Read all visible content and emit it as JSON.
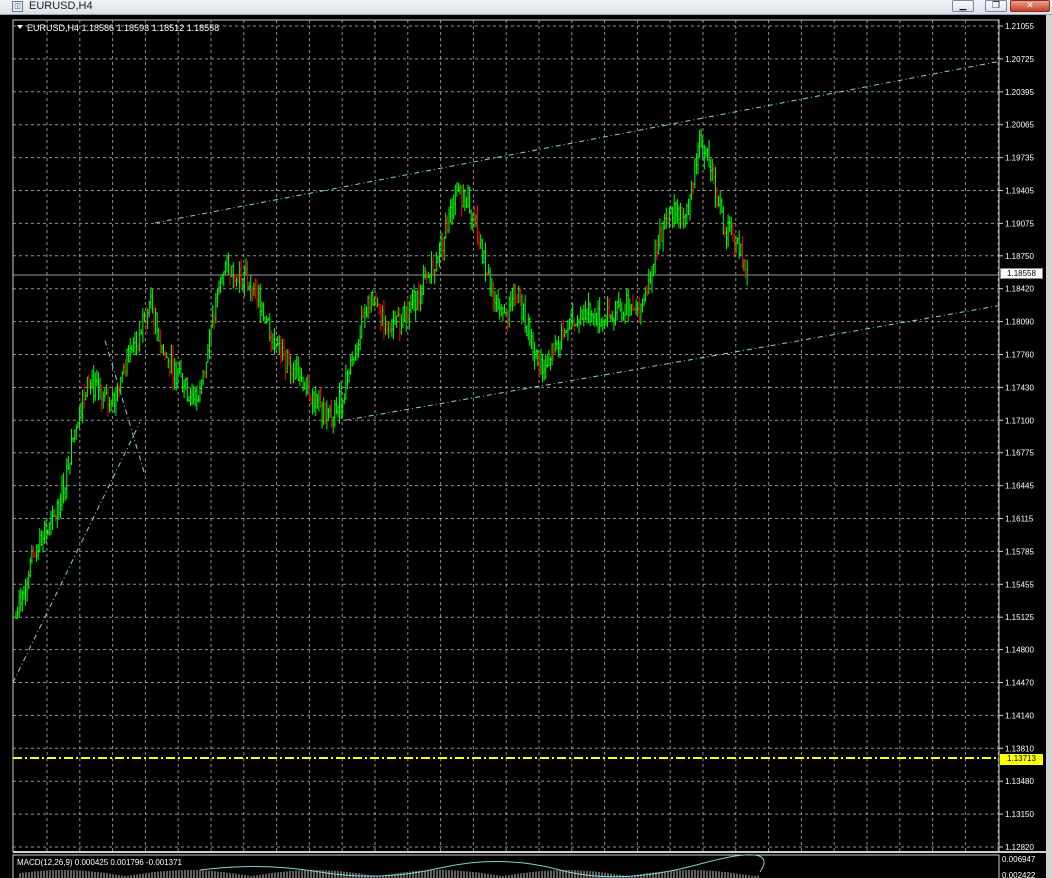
{
  "window": {
    "title": "EURUSD,H4",
    "icon": "chart-window-icon",
    "controls": {
      "minimize": "▁",
      "maximize": "❐",
      "close": "✕"
    }
  },
  "chart": {
    "symbol_info": "EURUSD,H4  1.18586 1.18593 1.18512 1.18558",
    "current_price": "1.18558",
    "level_price": "1.13713",
    "price_axis": [
      "1.21055",
      "1.20725",
      "1.20395",
      "1.20065",
      "1.19735",
      "1.19405",
      "1.19075",
      "1.18750",
      "1.18420",
      "1.18090",
      "1.17760",
      "1.17430",
      "1.17100",
      "1.16775",
      "1.16445",
      "1.16115",
      "1.15785",
      "1.15455",
      "1.15125",
      "1.14800",
      "1.14470",
      "1.14140",
      "1.13810",
      "1.13480",
      "1.13150",
      "1.12820"
    ],
    "macd_info": "MACD(12,26,9) 0.000425 0.001796 -0.001371",
    "macd_axis_top": "0.006947",
    "macd_axis_bottom": "0.002422",
    "colors": {
      "background": "#000000",
      "grid": "#c0c0c0",
      "candle_up": "#00ff00",
      "candle_down": "#ff0000",
      "trendline": "#7fd4d4",
      "level_line": "#ffff00",
      "axis_text": "#ffffff"
    }
  },
  "chart_data": {
    "type": "line",
    "title": "EURUSD,H4",
    "ohlc_last": {
      "open": 1.18586,
      "high": 1.18593,
      "low": 1.18512,
      "close": 1.18558
    },
    "ylim": [
      1.1282,
      1.21055
    ],
    "x": [
      0,
      4,
      8,
      12,
      16,
      20,
      24,
      28,
      32,
      36,
      40,
      44,
      48,
      52,
      56,
      60,
      64,
      68,
      72,
      76,
      80,
      84,
      88,
      92,
      96,
      100,
      104,
      108,
      112,
      116,
      120,
      124,
      128,
      132,
      136,
      140,
      144,
      148,
      152,
      156,
      160,
      164,
      168,
      172,
      176,
      180,
      184,
      188,
      192,
      196,
      200,
      204,
      208,
      212,
      216,
      220,
      224,
      228,
      232,
      236,
      240
    ],
    "series": [
      {
        "values": [
          1.1512,
          1.156,
          1.159,
          1.1605,
          1.165,
          1.1712,
          1.175,
          1.1732,
          1.1725,
          1.177,
          1.179,
          1.183,
          1.178,
          1.176,
          1.174,
          1.173,
          1.18,
          1.1865,
          1.186,
          1.185,
          1.183,
          1.1795,
          1.177,
          1.176,
          1.174,
          1.172,
          1.1712,
          1.1745,
          1.179,
          1.183,
          1.1812,
          1.18,
          1.182,
          1.1835,
          1.186,
          1.189,
          1.1935,
          1.1935,
          1.189,
          1.1835,
          1.181,
          1.184,
          1.18,
          1.1765,
          1.1785,
          1.18,
          1.1812,
          1.182,
          1.181,
          1.1815,
          1.1825,
          1.1815,
          1.186,
          1.19,
          1.1925,
          1.1915,
          1.199,
          1.196,
          1.1905,
          1.189,
          1.1856
        ]
      }
    ]
  }
}
